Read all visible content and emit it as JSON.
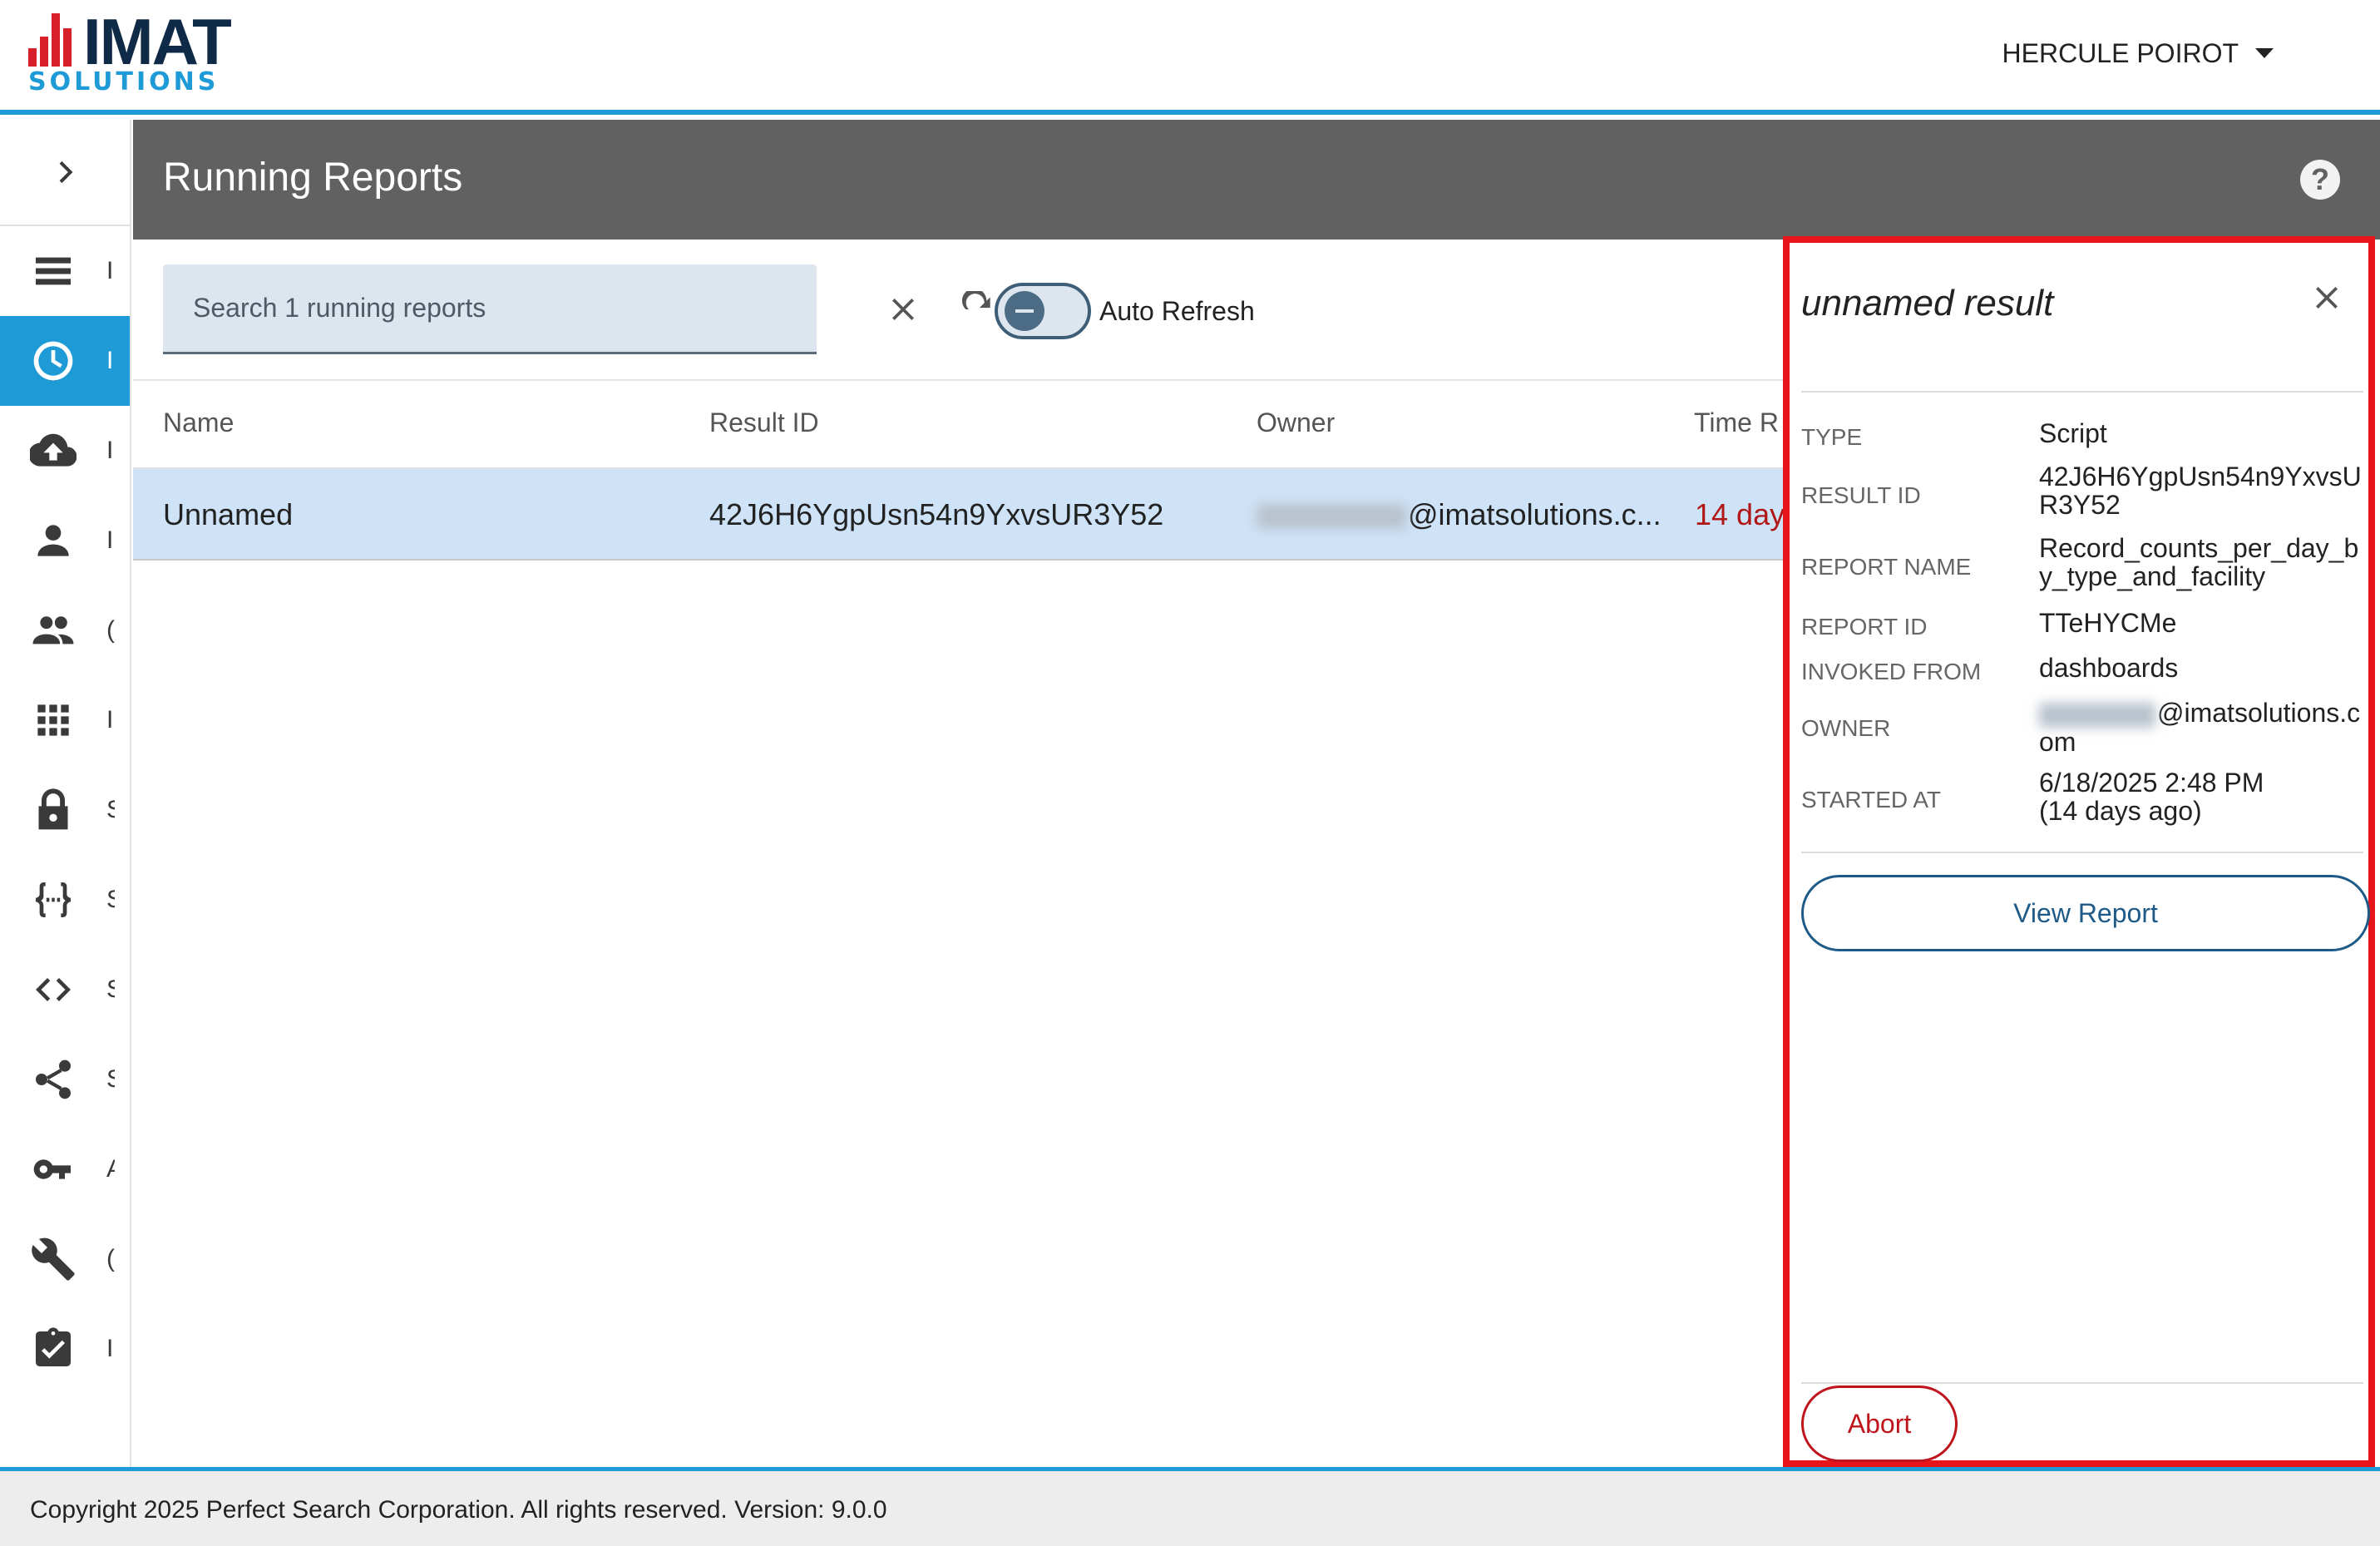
{
  "brand": {
    "logo_word": "IMAT",
    "logo_sub": "SOLUTIONS",
    "accent": "#1e9bd7",
    "logo_red": "#d71f2a",
    "logo_navy": "#0f2a47"
  },
  "header": {
    "user_name": "HERCULE POIROT"
  },
  "sidebar": {
    "expand_icon": "chevron-right-icon",
    "items": [
      {
        "icon": "list-icon",
        "label": "I"
      },
      {
        "icon": "clock-icon",
        "label": "I",
        "active": true
      },
      {
        "icon": "cloud-upload-icon",
        "label": "I"
      },
      {
        "icon": "person-icon",
        "label": "I"
      },
      {
        "icon": "people-icon",
        "label": "("
      },
      {
        "icon": "apps-grid-icon",
        "label": "I"
      },
      {
        "icon": "lock-icon",
        "label": "S"
      },
      {
        "icon": "braces-icon",
        "label": "S"
      },
      {
        "icon": "code-icon",
        "label": "S"
      },
      {
        "icon": "share-icon",
        "label": "S"
      },
      {
        "icon": "key-icon",
        "label": "A"
      },
      {
        "icon": "wrench-icon",
        "label": "("
      },
      {
        "icon": "clipboard-check-icon",
        "label": "I"
      }
    ]
  },
  "page": {
    "title": "Running Reports",
    "help_label": "?"
  },
  "toolbar": {
    "search_placeholder": "Search 1 running reports",
    "auto_refresh_label": "Auto Refresh",
    "auto_refresh_on": false
  },
  "table": {
    "columns": [
      "Name",
      "Result ID",
      "Owner",
      "Time R"
    ],
    "rows": [
      {
        "name": "Unnamed",
        "result_id": "42J6H6YgpUsn54n9YxvsUR3Y52",
        "owner": "@imatsolutions.c...",
        "time": "14 day"
      }
    ]
  },
  "detail": {
    "title": "unnamed result",
    "fields": [
      {
        "label": "TYPE",
        "value": "Script"
      },
      {
        "label": "RESULT ID",
        "value": "42J6H6YgpUsn54n9YxvsUR3Y52"
      },
      {
        "label": "REPORT NAME",
        "value": "Record_counts_per_day_by_type_and_facility"
      },
      {
        "label": "REPORT ID",
        "value": "TTeHYCMe"
      },
      {
        "label": "INVOKED FROM",
        "value": "dashboards"
      },
      {
        "label": "OWNER",
        "value": "@imatsolutions.com"
      },
      {
        "label": "STARTED AT",
        "value": "6/18/2025 2:48 PM (14 days ago)"
      }
    ],
    "view_button": "View Report",
    "abort_button": "Abort"
  },
  "footer": {
    "text": "Copyright 2025 Perfect Search Corporation. All rights reserved. Version: 9.0.0"
  }
}
